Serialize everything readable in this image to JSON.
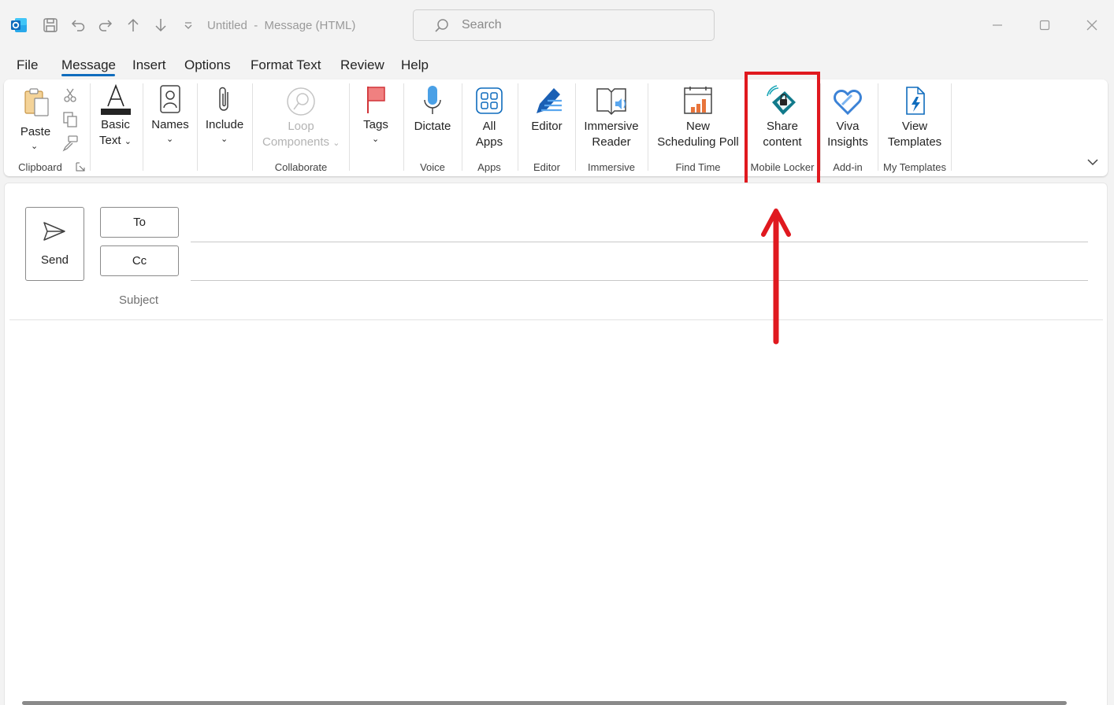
{
  "titlebar": {
    "title": "Untitled  -  Message (HTML)",
    "search_placeholder": "Search",
    "icons": [
      "outlook-logo",
      "save-icon",
      "undo-icon",
      "redo-icon",
      "up-arrow-icon",
      "down-arrow-icon",
      "customize-qat-icon"
    ]
  },
  "tabs": [
    "File",
    "Message",
    "Insert",
    "Options",
    "Format Text",
    "Review",
    "Help"
  ],
  "active_tab": "Message",
  "ribbon": {
    "paste": "Paste",
    "basic_text_1": "Basic",
    "basic_text_2": "Text",
    "names": "Names",
    "include": "Include",
    "loop_1": "Loop",
    "loop_2": "Components",
    "tags": "Tags",
    "dictate": "Dictate",
    "all_apps_1": "All",
    "all_apps_2": "Apps",
    "editor": "Editor",
    "immersive_1": "Immersive",
    "immersive_2": "Reader",
    "poll_1": "New",
    "poll_2": "Scheduling Poll",
    "share_1": "Share",
    "share_2": "content",
    "viva_1": "Viva",
    "viva_2": "Insights",
    "templates_1": "View",
    "templates_2": "Templates",
    "groups": {
      "clipboard": "Clipboard",
      "collaborate": "Collaborate",
      "voice": "Voice",
      "apps": "Apps",
      "editor": "Editor",
      "immersive": "Immersive",
      "find_time": "Find Time",
      "mobile_locker": "Mobile Locker",
      "add_in": "Add-in",
      "my_templates": "My Templates"
    }
  },
  "compose": {
    "send": "Send",
    "to": "To",
    "cc": "Cc",
    "subject": "Subject"
  },
  "colors": {
    "accent": "#0f6cbd",
    "highlight": "#e0191f"
  }
}
